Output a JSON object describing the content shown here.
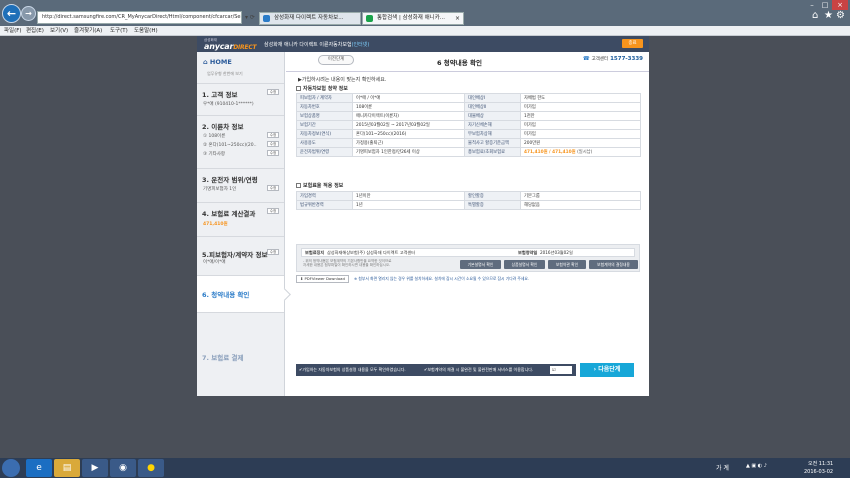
{
  "browser": {
    "url": "http://direct.samsungfire.com/CR_MyAnycarDirect/Html/component/cfcarcar/SelectEti...",
    "tabs": [
      {
        "label": "삼성화재 다이렉트 자동차보..."
      },
      {
        "label": "통합검색 | 삼성화재 애니카..."
      }
    ],
    "menu": [
      "파일(F)",
      "편집(E)",
      "보기(V)",
      "즐겨찾기(A)",
      "도구(T)",
      "도움말(H)"
    ]
  },
  "header": {
    "logo_small": "삼성화재",
    "logo_main": "anycar",
    "logo_accent": "DIRECT",
    "title_prefix": "삼성화재 애니카 다이렉트 이륜자동차보험",
    "title_highlight": "(인터넷)",
    "close_label": "종료"
  },
  "sidebar": {
    "home_label": "HOME",
    "home_sub": "업무유형 한번에 보기",
    "steps": [
      {
        "title": "1. 고객 정보",
        "sub": [
          "우*애 (910410-1******)"
        ],
        "btn": "수정"
      },
      {
        "title": "2. 이륜차 정보",
        "sub": [
          "① 108이륜",
          "② 혼다(101~250cc)(20..",
          "③ 기타사항"
        ],
        "btn": "수정"
      },
      {
        "title": "3. 운전자 범위/연령",
        "sub": [
          "기명피보험자 1인"
        ],
        "btn": "수정"
      },
      {
        "title": "4. 보험료 계산결과",
        "sub": [
          "471,410원"
        ],
        "btn": "수정"
      },
      {
        "title": "5.피보험자/계약자 정보",
        "sub": [
          "이*애/이*애"
        ],
        "btn": "수정"
      },
      {
        "title": "6. 청약내용 확인"
      },
      {
        "title": "7. 보험료 결제"
      }
    ]
  },
  "main": {
    "prev_label": "이전단계",
    "title": "6 청약내용 확인",
    "cs_label": "고객센터",
    "cs_number": "1577-3339",
    "notice": "가입하시려는 내용이 맞는지 확인하세요.",
    "section1": "자동차보험 청약 정보",
    "section2": "보험료율 적용 정보",
    "table1": [
      [
        "피보험자 / 계약자",
        "이*애 / 이*애",
        "대인배상Ⅰ",
        "자배법 한도"
      ],
      [
        "자동차번호",
        "108이륜",
        "대인배상Ⅱ",
        "미가입"
      ],
      [
        "보험상품명",
        "애니카다이렉트(이륜차)",
        "대물배상",
        "1천만"
      ],
      [
        "보험기간",
        "2015년03월02일 ~ 2017년03월02일",
        "자기신체손해",
        "미가입"
      ],
      [
        "자동차정보(연식)",
        "혼다(101~250cc)(2016)",
        "무보험차상해",
        "미가입"
      ],
      [
        "사용용도",
        "가정용(출퇴근)",
        "물적사고 할증기준금액",
        "200만원"
      ],
      [
        "운전자범위/연령",
        "기명피보험자 1인한정/만26세 이상",
        "총보험료/초회보험료",
        "471,410원 / 471,410원"
      ]
    ],
    "premium_note": "(일시납)",
    "table2": [
      [
        "가입경력",
        "1년이만",
        "할인할증",
        "기본그룹"
      ],
      [
        "법규위반경력",
        "1년",
        "특별할증",
        "해당없음"
      ]
    ],
    "payer_label": "보험료징지",
    "payer_value": "삼성화재해상보험(주) 삼성화재 다이렉트 고객센터",
    "start_label": "보험청약일",
    "start_value": "2016년03월02일",
    "notes": [
      "- 위의 청약내용은 보험계약의 기본사항만을 요약한 것이므로",
      "  자세한 내용은 첨부파일이 확인하시면 내용을 확인하십시오."
    ],
    "buttons": [
      "기본설명서 확인",
      "상품설명서 확인",
      "보험약관 확인",
      "보험계약의 결정내용"
    ],
    "pdf_label": "PDFViewer Download",
    "pdf_note": "※ 첨부서 화면 열리지 않는 경우 위를 설치하세요. 설치에 잠시 시간이 소요될 수 있으므로 잠시 기다려 주세요.",
    "agree_1": "가입하는 자동차보험의 상품설명 내용을 모두 확인하였습니다.",
    "agree_2": "보험계약의 체결 시 불완전 및 불완전판매 서비스를 이용합니다.",
    "confirm_label": "확인",
    "next_label": "다음단계"
  },
  "taskbar": {
    "lang": "가 계",
    "clock_label": "오전 11:31",
    "date": "2016-03-02"
  }
}
